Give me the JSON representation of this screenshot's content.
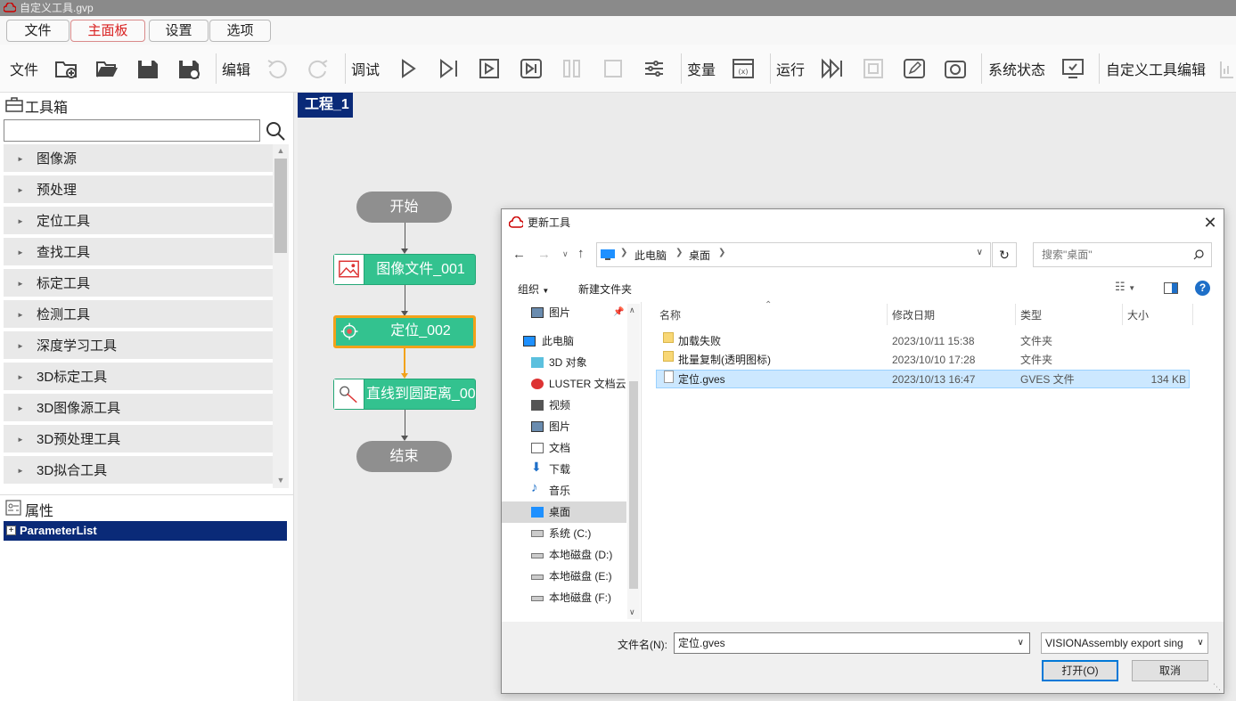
{
  "window": {
    "title": "自定义工具.gvp"
  },
  "menu": {
    "tabs": [
      "文件",
      "主面板",
      "设置",
      "选项"
    ],
    "active": "主面板"
  },
  "toolbar": {
    "file": "文件",
    "edit": "编辑",
    "debug": "调试",
    "variable": "变量",
    "run": "运行",
    "system_status": "系统状态",
    "custom_tool_edit": "自定义工具编辑"
  },
  "toolbox": {
    "title": "工具箱",
    "search_value": "",
    "categories": [
      "图像源",
      "预处理",
      "定位工具",
      "查找工具",
      "标定工具",
      "检测工具",
      "深度学习工具",
      "3D标定工具",
      "3D图像源工具",
      "3D预处理工具",
      "3D拟合工具"
    ]
  },
  "properties": {
    "title": "属性",
    "row": "ParameterList"
  },
  "canvas": {
    "tab": "工程_1",
    "start": "开始",
    "end": "结束",
    "nodes": [
      "图像文件_001",
      "定位_002",
      "直线到圆距离_003"
    ]
  },
  "dialog": {
    "title": "更新工具",
    "breadcrumb": [
      "此电脑",
      "桌面"
    ],
    "search_placeholder": "搜索\"桌面\"",
    "organize": "组织",
    "new_folder": "新建文件夹",
    "nav": [
      "图片",
      "此电脑",
      "3D 对象",
      "LUSTER 文档云",
      "视频",
      "图片",
      "文档",
      "下载",
      "音乐",
      "桌面",
      "系统 (C:)",
      "本地磁盘 (D:)",
      "本地磁盘 (E:)",
      "本地磁盘 (F:)"
    ],
    "columns": [
      "名称",
      "修改日期",
      "类型",
      "大小"
    ],
    "files": [
      {
        "name": "加载失败",
        "date": "2023/10/11 15:38",
        "type": "文件夹",
        "size": ""
      },
      {
        "name": "批量复制(透明图标)",
        "date": "2023/10/10 17:28",
        "type": "文件夹",
        "size": ""
      },
      {
        "name": "定位.gves",
        "date": "2023/10/13 16:47",
        "type": "GVES 文件",
        "size": "134 KB"
      }
    ],
    "filename_label": "文件名(N):",
    "filename_value": "定位.gves",
    "filetype_value": "VISIONAssembly export sing",
    "open_button": "打开(O)",
    "cancel_button": "取消"
  }
}
